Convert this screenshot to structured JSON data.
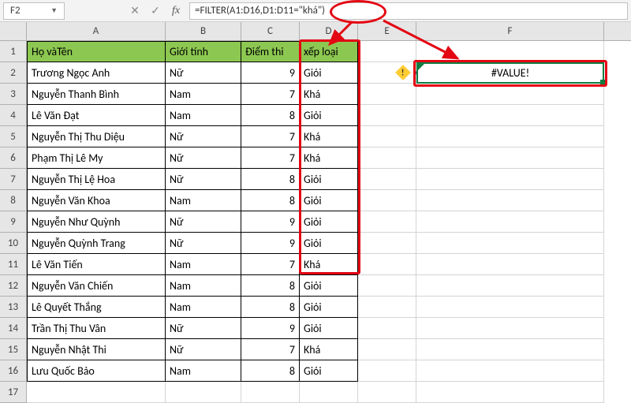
{
  "nameBox": "F2",
  "formula_prefix": "=FILTER(A1:D16,",
  "formula_highlight": "D1:D11",
  "formula_suffix": "=\"khá\")",
  "columns": [
    "A",
    "B",
    "C",
    "D",
    "E",
    "F"
  ],
  "headers": {
    "A": "Họ vàTên",
    "B": "Giới tính",
    "C": "Điểm thi",
    "D": "xếp loại"
  },
  "rows": [
    {
      "n": 1
    },
    {
      "n": 2,
      "A": "Trương Ngọc Anh",
      "B": "Nữ",
      "C": "9",
      "D": "Giỏi"
    },
    {
      "n": 3,
      "A": "Nguyễn Thanh Bình",
      "B": "Nam",
      "C": "7",
      "D": "Khá"
    },
    {
      "n": 4,
      "A": "Lê Văn Đạt",
      "B": "Nam",
      "C": "8",
      "D": "Giỏi"
    },
    {
      "n": 5,
      "A": "Nguyễn Thị Thu Diệu",
      "B": "Nữ",
      "C": "7",
      "D": "Khá"
    },
    {
      "n": 6,
      "A": "Phạm Thị Lê My",
      "B": "Nữ",
      "C": "7",
      "D": "Khá"
    },
    {
      "n": 7,
      "A": "Nguyễn Thị Lệ Hoa",
      "B": "Nữ",
      "C": "8",
      "D": "Giỏi"
    },
    {
      "n": 8,
      "A": "Nguyễn Văn Khoa",
      "B": "Nam",
      "C": "8",
      "D": "Giỏi"
    },
    {
      "n": 9,
      "A": "Nguyễn Như Quỳnh",
      "B": "Nữ",
      "C": "9",
      "D": "Giỏi"
    },
    {
      "n": 10,
      "A": "Nguyễn Quỳnh Trang",
      "B": "Nữ",
      "C": "9",
      "D": "Giỏi"
    },
    {
      "n": 11,
      "A": "Lê Văn Tiến",
      "B": "Nam",
      "C": "7",
      "D": "Khá"
    },
    {
      "n": 12,
      "A": "Nguyễn Văn Chiến",
      "B": "Nam",
      "C": "8",
      "D": "Giỏi"
    },
    {
      "n": 13,
      "A": "Lê Quyết Thắng",
      "B": "Nam",
      "C": "8",
      "D": "Giỏi"
    },
    {
      "n": 14,
      "A": "Trần Thị Thu Vân",
      "B": "Nữ",
      "C": "9",
      "D": "Giỏi"
    },
    {
      "n": 15,
      "A": "Nguyễn Nhật Thi",
      "B": "Nữ",
      "C": "7",
      "D": "Khá"
    },
    {
      "n": 16,
      "A": "Lưu Quốc Bảo",
      "B": "Nam",
      "C": "8",
      "D": "Giỏi"
    },
    {
      "n": 17
    }
  ],
  "resultCell": "#VALUE!",
  "errorGlyph": "!"
}
